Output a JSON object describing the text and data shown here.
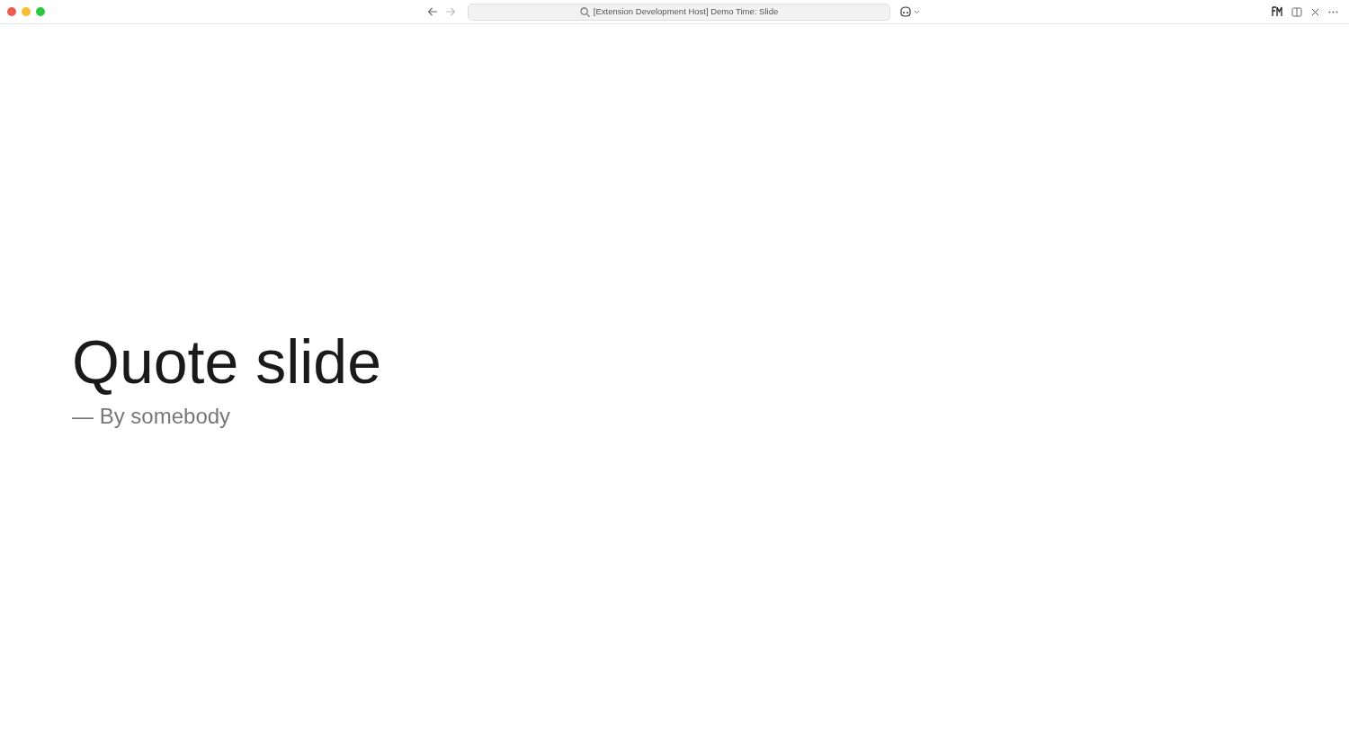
{
  "title_bar": {
    "nav": [
      {
        "kind": "back",
        "disabled": false
      },
      {
        "kind": "forward",
        "disabled": true
      }
    ],
    "search": {
      "value": "[Extension Development Host] Demo Time: Slide"
    }
  },
  "slide": {
    "quote": "Quote slide",
    "author": "— By somebody"
  }
}
